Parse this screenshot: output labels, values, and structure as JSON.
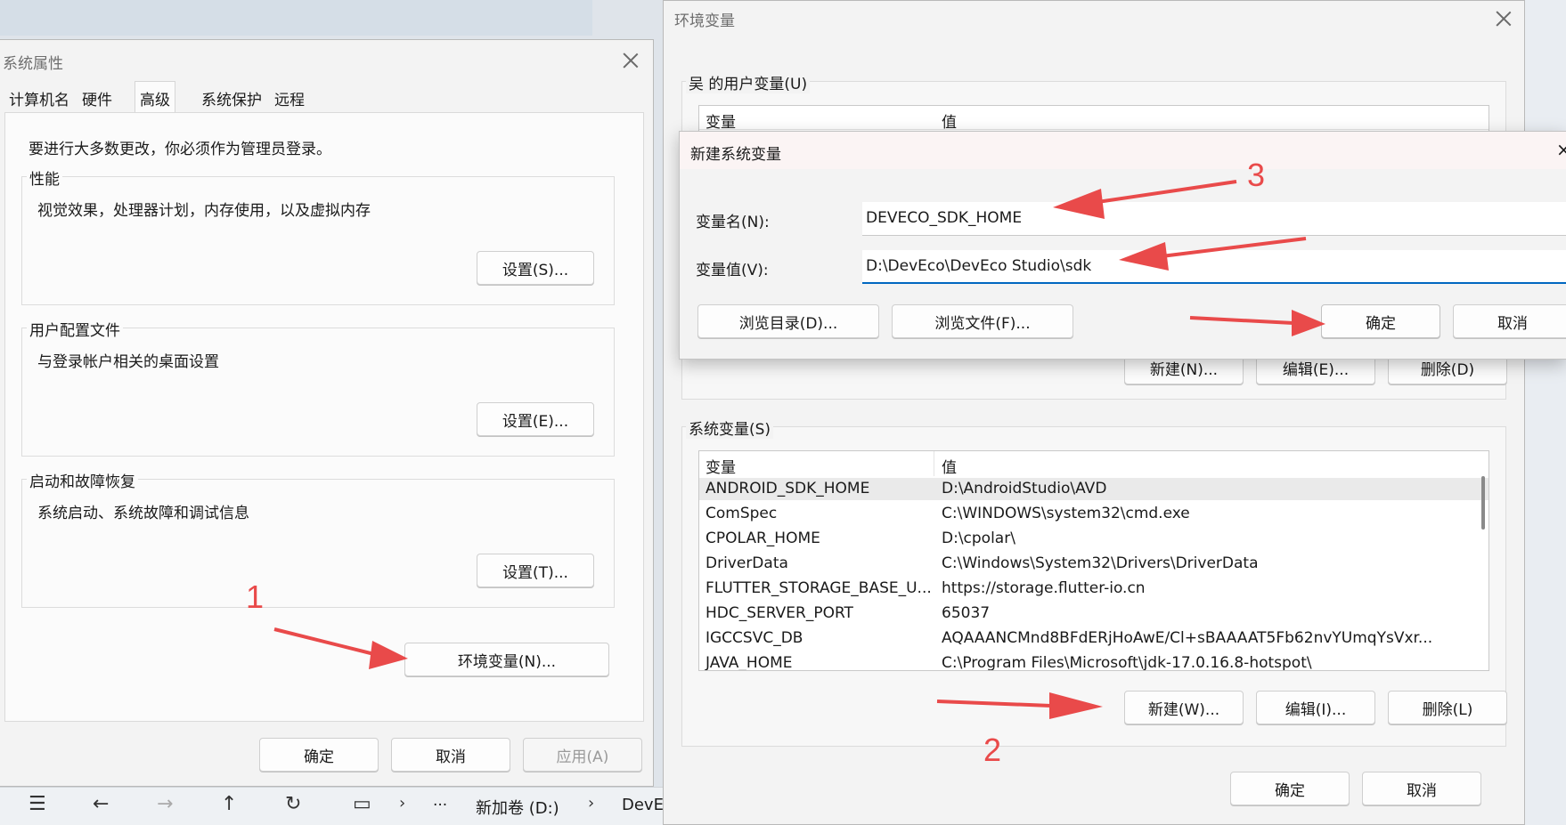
{
  "sys_props": {
    "title": "系统属性",
    "tabs": [
      "计算机名",
      "硬件",
      "高级",
      "系统保护",
      "远程"
    ],
    "active_tab": "高级",
    "admin_note": "要进行大多数更改，你必须作为管理员登录。",
    "performance": {
      "title": "性能",
      "desc": "视觉效果，处理器计划，内存使用，以及虚拟内存",
      "button": "设置(S)..."
    },
    "user_profile": {
      "title": "用户配置文件",
      "desc": "与登录帐户相关的桌面设置",
      "button": "设置(E)..."
    },
    "startup": {
      "title": "启动和故障恢复",
      "desc": "系统启动、系统故障和调试信息",
      "button": "设置(T)..."
    },
    "env_button": "环境变量(N)...",
    "ok": "确定",
    "cancel": "取消",
    "apply": "应用(A)"
  },
  "env_vars": {
    "title": "环境变量",
    "user_section": "吴 的用户变量(U)",
    "user_header": {
      "var": "变量",
      "val": "值"
    },
    "user_buttons": {
      "new": "新建(N)...",
      "edit": "编辑(E)...",
      "delete": "删除(D)"
    },
    "sys_section": "系统变量(S)",
    "sys_header": {
      "var": "变量",
      "val": "值"
    },
    "sys_rows": [
      {
        "var": "ANDROID_SDK_HOME",
        "val": "D:\\AndroidStudio\\AVD"
      },
      {
        "var": "ComSpec",
        "val": "C:\\WINDOWS\\system32\\cmd.exe"
      },
      {
        "var": "CPOLAR_HOME",
        "val": "D:\\cpolar\\"
      },
      {
        "var": "DriverData",
        "val": "C:\\Windows\\System32\\Drivers\\DriverData"
      },
      {
        "var": "FLUTTER_STORAGE_BASE_U...",
        "val": "https://storage.flutter-io.cn"
      },
      {
        "var": "HDC_SERVER_PORT",
        "val": "65037"
      },
      {
        "var": "IGCCSVC_DB",
        "val": "AQAAANCMnd8BFdERjHoAwE/Cl+sBAAAAT5Fb62nvYUmqYsVxr..."
      },
      {
        "var": "JAVA_HOME",
        "val": "C:\\Program Files\\Microsoft\\jdk-17.0.16.8-hotspot\\"
      }
    ],
    "sys_buttons": {
      "new": "新建(W)...",
      "edit": "编辑(I)...",
      "delete": "删除(L)"
    },
    "ok": "确定",
    "cancel": "取消"
  },
  "new_var_dialog": {
    "title": "新建系统变量",
    "name_label": "变量名(N):",
    "name_value": "DEVECO_SDK_HOME",
    "value_label": "变量值(V):",
    "value_value": "D:\\DevEco\\DevEco Studio\\sdk",
    "browse_dir": "浏览目录(D)...",
    "browse_file": "浏览文件(F)...",
    "ok": "确定",
    "cancel": "取消"
  },
  "annotations": [
    "1",
    "2",
    "3"
  ],
  "explorer_bar": {
    "drive": "新加卷 (D:)",
    "folder": "DevE",
    "ellipsis": "···"
  },
  "colors": {
    "accent": "#0067c0",
    "arrow": "#e94a4a"
  }
}
